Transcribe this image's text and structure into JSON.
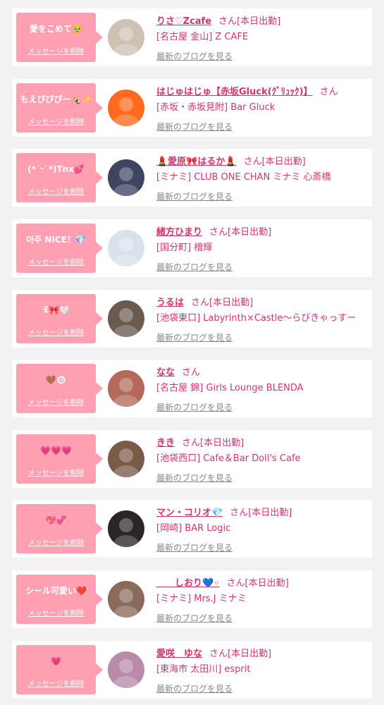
{
  "theme": {
    "accent": "#d6336c",
    "bubble": "#ff9fb1",
    "link_gray": "#888888"
  },
  "labels": {
    "suffix": "さん",
    "delete": "メッセージを削除",
    "blog": "最新のブログを見る"
  },
  "cards": [
    {
      "message": "愛をこめて🥹",
      "name": "りさ♡Zcafe",
      "status": "[本日出勤]",
      "shop": "[名古屋 金山] Z CAFE",
      "avatar_color": "#cfc2b5"
    },
    {
      "message": "もえぴぴぴー🍾✨",
      "name": "はじゅはじゅ【赤坂Gluck(ｸﾞﾘｭｯｸ)】",
      "status": "",
      "shop": "[赤坂・赤坂見附] Bar Gluck",
      "avatar_color": "#ff6a1e"
    },
    {
      "message": "(*´ᵕ`*)Tnx💕",
      "name": "💄愛原🎀はるか💄",
      "status": "[本日出勤]",
      "shop": "[ミナミ] CLUB ONE CHAN ミナミ 心斎橋",
      "avatar_color": "#3e4560"
    },
    {
      "message": "아주 NICE！💎",
      "name": "緒方ひまり",
      "status": "[本日出勤]",
      "shop": "[国分町] 檜輝",
      "avatar_color": "#d9e2ec"
    },
    {
      "message": "ꉂ🎀🤍",
      "name": "うるは",
      "status": "[本日出勤]",
      "shop": "[池袋東口] Labyrinth×Castle〜らびきゃっすー",
      "avatar_color": "#6b5a50"
    },
    {
      "message": "🤎🍥",
      "name": "なな",
      "status": "",
      "shop": "[名古屋 錦] Girls Lounge BLENDA",
      "avatar_color": "#b46a5a"
    },
    {
      "message": "💗💗💗",
      "name": "きき",
      "status": "[本日出勤]",
      "shop": "[池袋西口] Cafe＆Bar Doll's Cafe",
      "avatar_color": "#7a5a48"
    },
    {
      "message": "💖💞",
      "name": "マン・コリオ💎",
      "status": "[本日出勤]",
      "shop": "[岡崎] BAR Logic",
      "avatar_color": "#2a2626"
    },
    {
      "message": "シール可愛い❤️",
      "name": "　　しおり💙◦",
      "status": "[本日出勤]",
      "shop": "[ミナミ] Mrs.J ミナミ",
      "avatar_color": "#8a6a5a"
    },
    {
      "message": "💗",
      "name": "愛咲　ゆな",
      "status": "[本日出勤]",
      "shop": "[東海市 太田川] esprit",
      "avatar_color": "#b98ba9"
    }
  ]
}
